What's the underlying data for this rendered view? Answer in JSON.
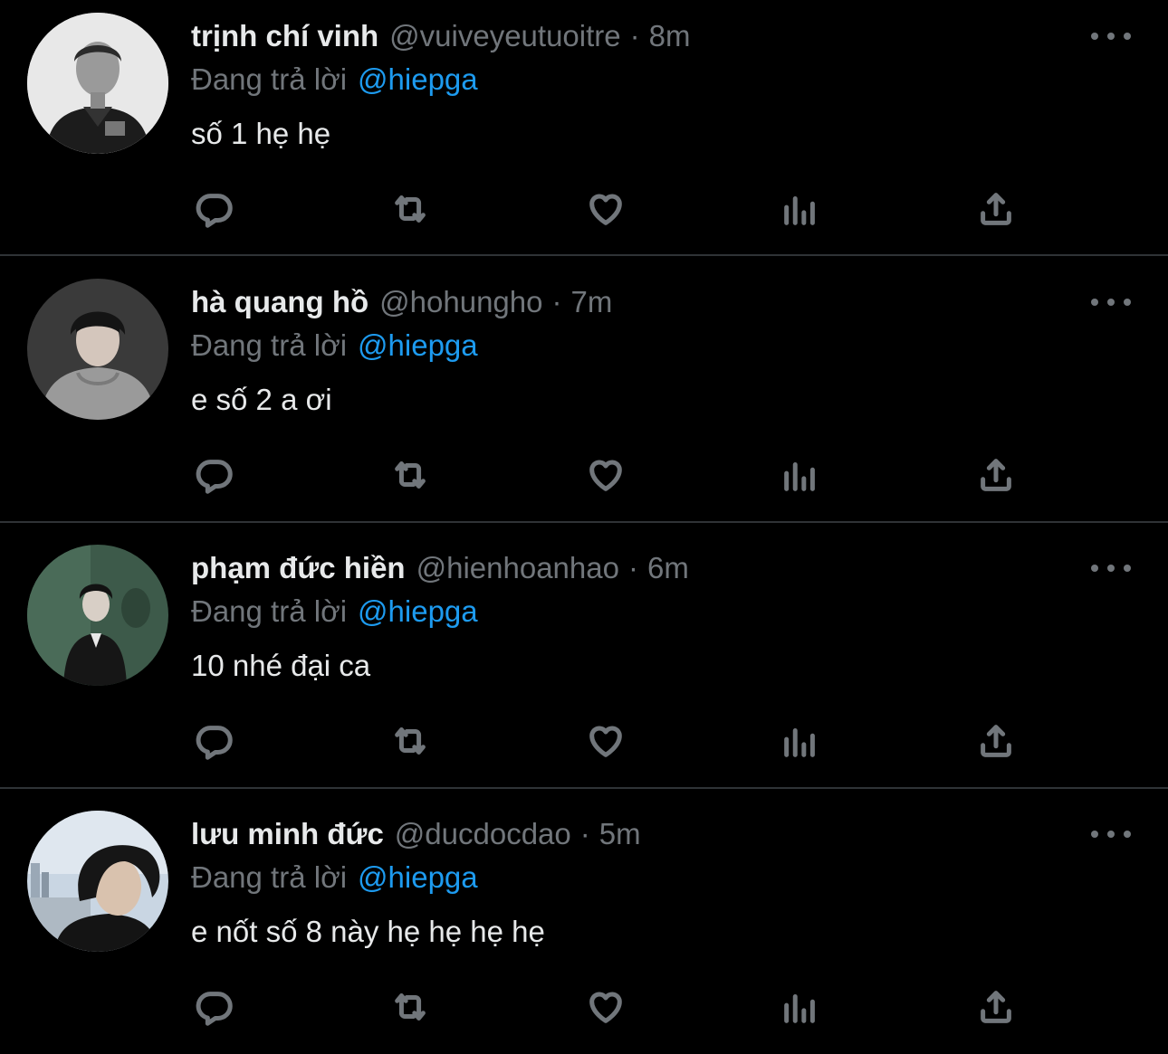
{
  "colors": {
    "background": "#000000",
    "divider": "#2f3336",
    "primary_text": "#e7e9ea",
    "secondary_text": "#71767b",
    "mention": "#1d9bf0"
  },
  "actions": {
    "reply_icon": "reply-icon",
    "retweet_icon": "retweet-icon",
    "like_icon": "heart-icon",
    "views_icon": "views-bar-chart-icon",
    "share_icon": "share-icon",
    "more_icon": "more-dots-icon"
  },
  "tweets": [
    {
      "display_name": "trịnh chí vinh",
      "handle": "@vuiveyeutuoitre",
      "separator": "·",
      "time": "8m",
      "reply_prefix": "Đang trả lời",
      "reply_to": "@hiepga",
      "text": "số 1 hẹ hẹ"
    },
    {
      "display_name": "hà quang hồ",
      "handle": "@hohungho",
      "separator": "·",
      "time": "7m",
      "reply_prefix": "Đang trả lời",
      "reply_to": "@hiepga",
      "text": "e số 2 a ơi"
    },
    {
      "display_name": "phạm đức hiền",
      "handle": "@hienhoanhao",
      "separator": "·",
      "time": "6m",
      "reply_prefix": "Đang trả lời",
      "reply_to": "@hiepga",
      "text": "10 nhé đại ca"
    },
    {
      "display_name": "lưu minh đức",
      "handle": "@ducdocdao",
      "separator": "·",
      "time": "5m",
      "reply_prefix": "Đang trả lời",
      "reply_to": "@hiepga",
      "text": "e nốt số 8 này hẹ hẹ hẹ hẹ"
    }
  ]
}
